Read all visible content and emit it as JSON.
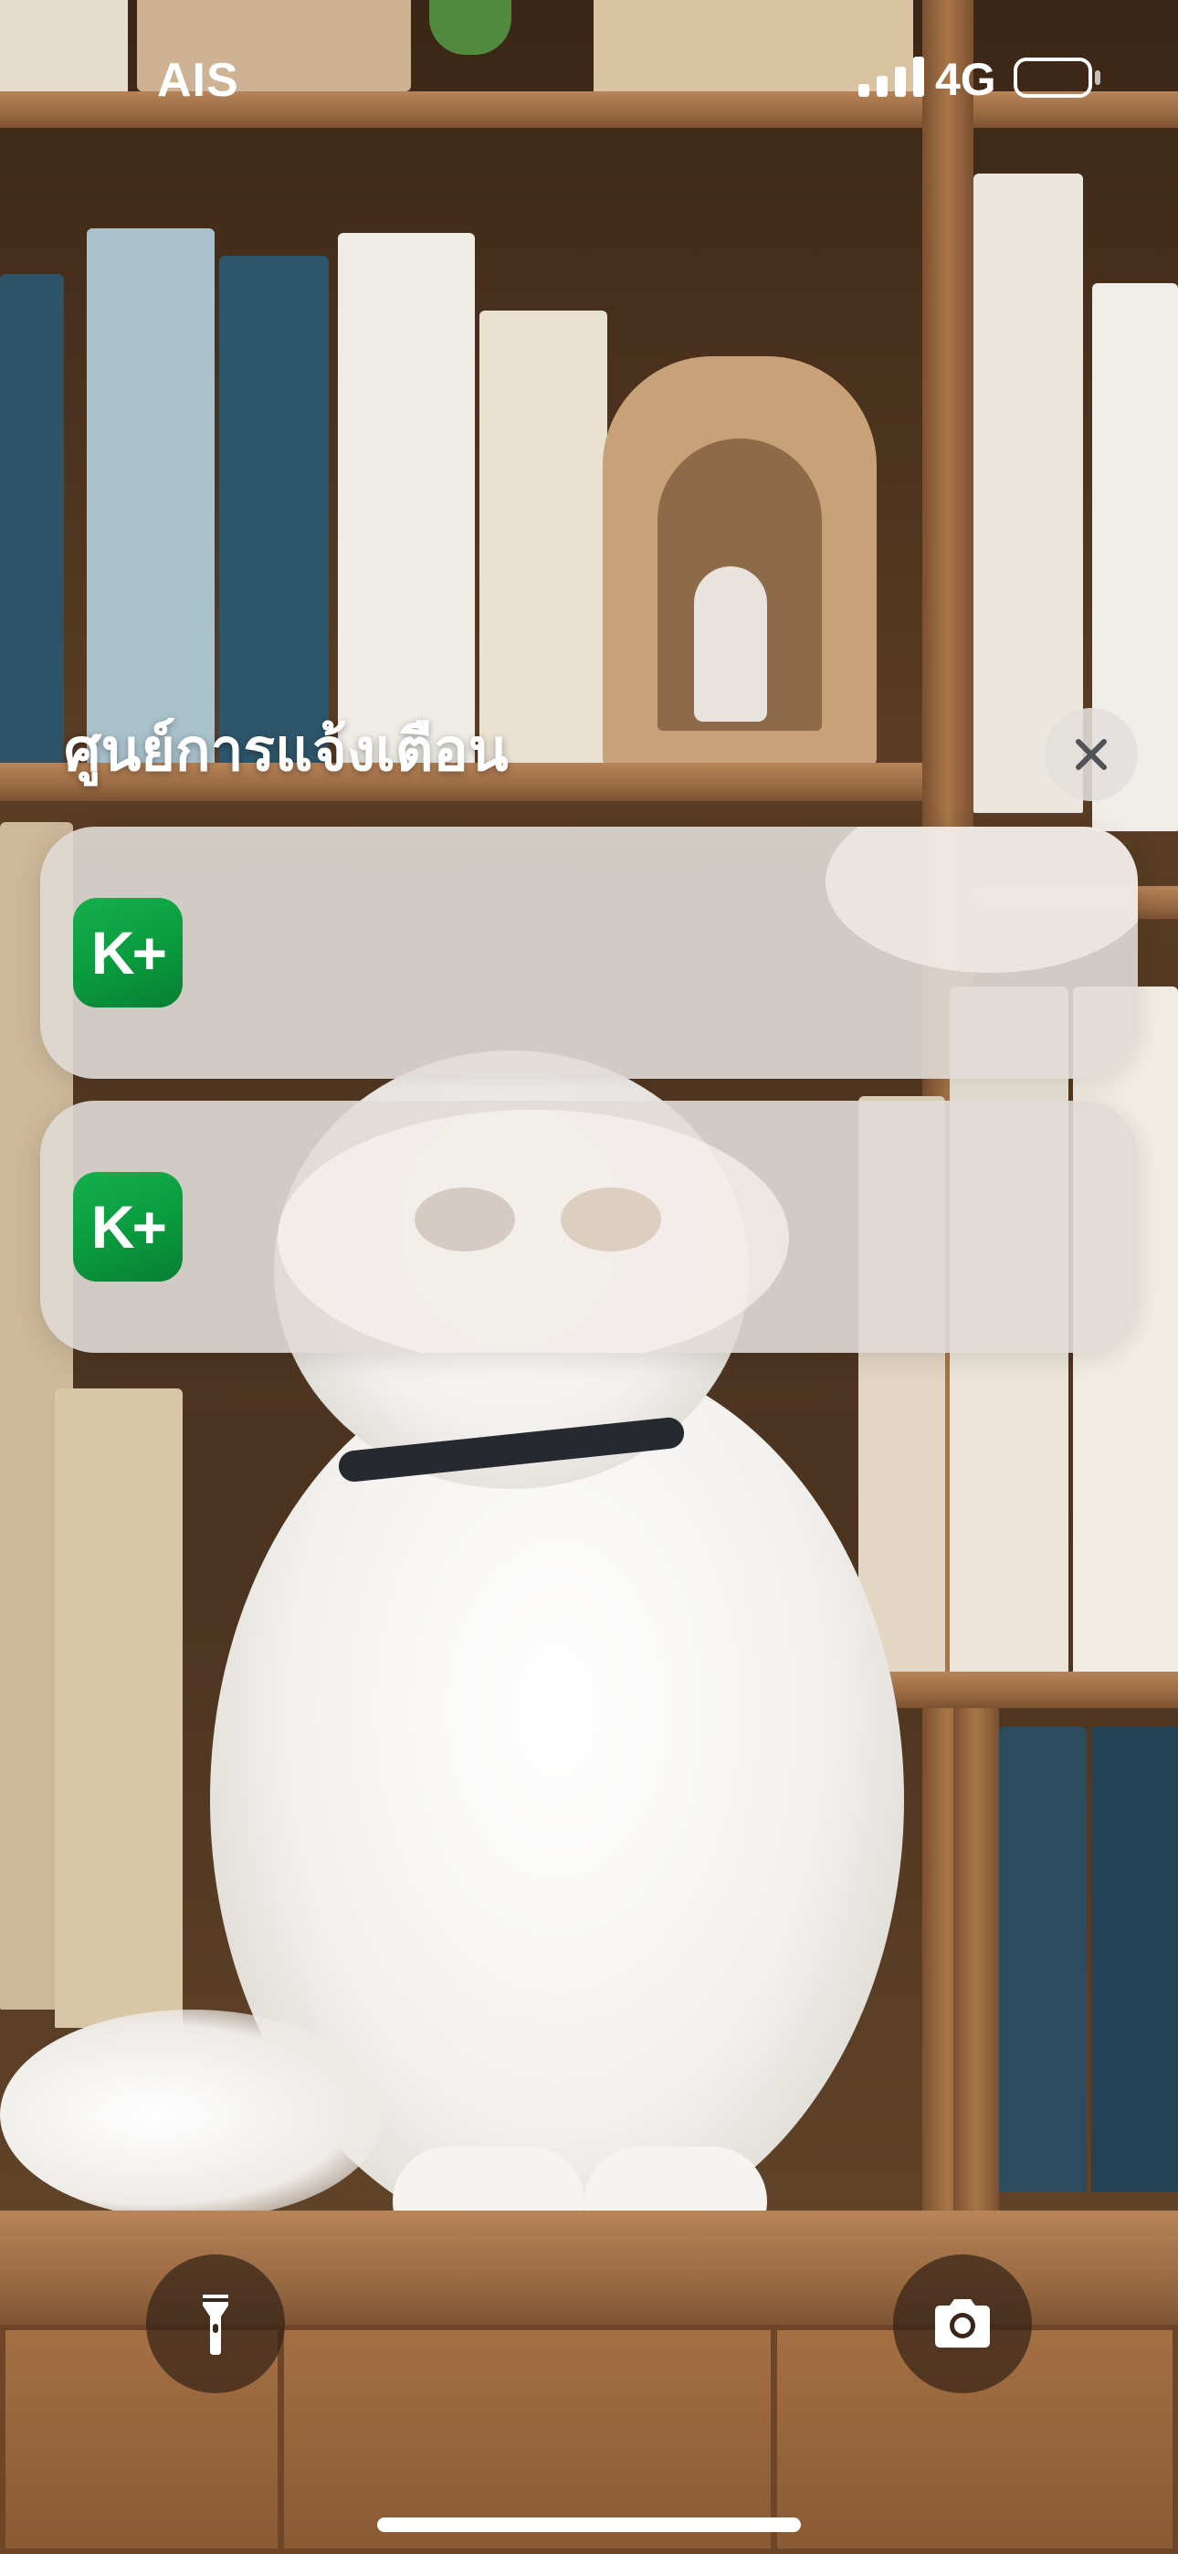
{
  "status_bar": {
    "carrier": "AIS",
    "network": "4G",
    "signal_icon": "cellular-signal-icon",
    "battery_icon": "battery-icon"
  },
  "notification_center": {
    "title": "ศูนย์การแจ้งเตือน",
    "clear_icon": "close-icon",
    "notifications": [
      {
        "app_icon_text": "K+",
        "app_icon": "kplus-app-icon"
      },
      {
        "app_icon_text": "K+",
        "app_icon": "kplus-app-icon"
      }
    ]
  },
  "quick_actions": {
    "left_icon": "flashlight-icon",
    "right_icon": "camera-icon"
  },
  "colors": {
    "app_icon_green": "#0a9a3e",
    "notification_bg": "#e0dad6",
    "text_white": "#ffffff"
  }
}
